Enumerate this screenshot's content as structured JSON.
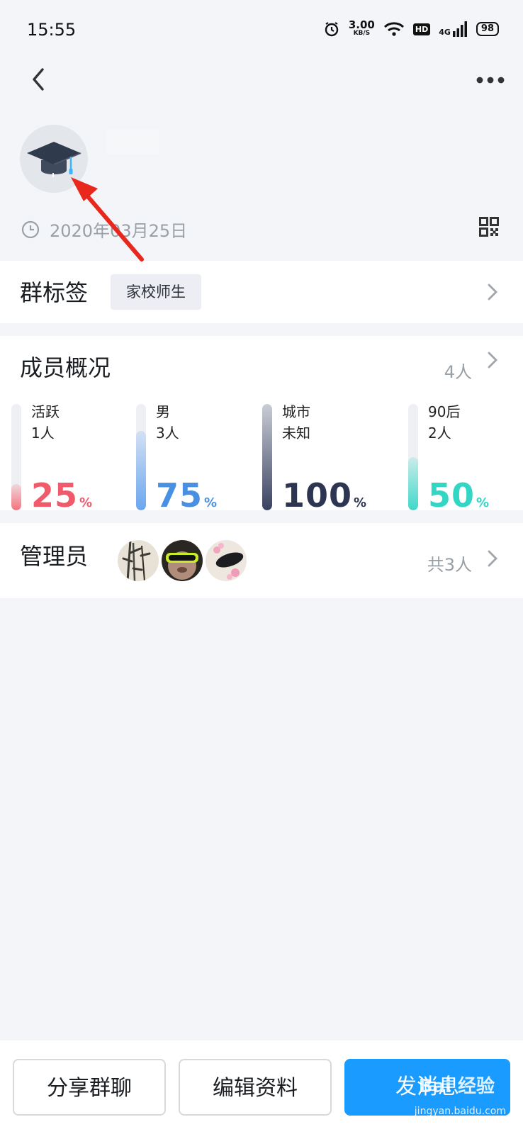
{
  "status_bar": {
    "time": "15:55",
    "net_speed": "3.00",
    "net_unit": "KB/S",
    "hd": "HD",
    "network": "4G",
    "battery": "98",
    "icons": [
      "alarm-icon",
      "wifi-icon",
      "signal-icon",
      "battery-icon"
    ]
  },
  "nav": {
    "back_icon": "chevron-left-icon",
    "more_icon": "more-dots-icon"
  },
  "group": {
    "avatar_icon": "graduation-cap-icon",
    "created_date": "2020年03月25日",
    "clock_icon": "clock-icon",
    "qr_icon": "qr-code-icon"
  },
  "tags": {
    "title": "群标签",
    "chip": "家校师生"
  },
  "members": {
    "title": "成员概况",
    "count": "4人",
    "stats": [
      {
        "label": "活跃",
        "value": "1人",
        "percent": "25",
        "unit": "%",
        "fill": 0.25,
        "color": "#f05a6b",
        "fill_color": "#f4737f"
      },
      {
        "label": "男",
        "value": "3人",
        "percent": "75",
        "unit": "%",
        "fill": 0.75,
        "color": "#4a90e2",
        "fill_color": "#6aa6f0"
      },
      {
        "label": "城市",
        "value": "未知",
        "percent": "100",
        "unit": "%",
        "fill": 1.0,
        "color": "#2d3550",
        "fill_color": "#3a4260"
      },
      {
        "label": "90后",
        "value": "2人",
        "percent": "50",
        "unit": "%",
        "fill": 0.5,
        "color": "#33d6c5",
        "fill_color": "#3fd9c8"
      }
    ]
  },
  "admins": {
    "title": "管理员",
    "total": "共3人",
    "avatars": [
      "bamboo-avatar",
      "goggles-avatar",
      "flower-avatar"
    ]
  },
  "bottom": {
    "share": "分享群聊",
    "edit": "编辑资料",
    "send": "发消息"
  },
  "watermark": {
    "text": "Bai 经验",
    "sub": "jingyan.baidu.com"
  },
  "colors": {
    "primary": "#1a9bff",
    "annotation_arrow": "#e8271d"
  }
}
